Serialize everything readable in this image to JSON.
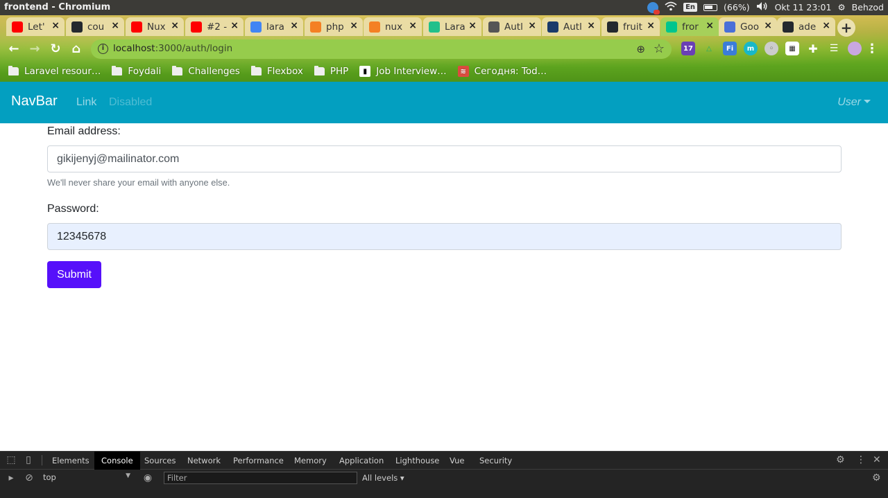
{
  "os": {
    "window_title": "frontend - Chromium",
    "lang": "En",
    "battery": "(66%)",
    "datetime": "Okt 11 23:01",
    "user": "Behzod"
  },
  "tabs": [
    {
      "label": "Let'",
      "icon": "youtube-icon",
      "color": "#ff0000"
    },
    {
      "label": "cou",
      "icon": "github-icon",
      "color": "#24292e"
    },
    {
      "label": "Nux",
      "icon": "youtube-icon",
      "color": "#ff0000"
    },
    {
      "label": "#2 -",
      "icon": "youtube-icon",
      "color": "#ff0000"
    },
    {
      "label": "lara",
      "icon": "google-icon",
      "color": "#4285f4"
    },
    {
      "label": "php",
      "icon": "stackoverflow-icon",
      "color": "#f48024"
    },
    {
      "label": "nux",
      "icon": "stackoverflow-icon",
      "color": "#f48024"
    },
    {
      "label": "Lara",
      "icon": "laracasts-icon",
      "color": "#21c08b"
    },
    {
      "label": "Autl",
      "icon": "avatar-icon",
      "color": "#555555"
    },
    {
      "label": "Autl",
      "icon": "plane-icon",
      "color": "#1a3a6a"
    },
    {
      "label": "fruit",
      "icon": "github-icon",
      "color": "#24292e"
    },
    {
      "label": "fror",
      "icon": "nuxt-icon",
      "color": "#00c58e"
    },
    {
      "label": "Goo",
      "icon": "translate-icon",
      "color": "#4a6fd8"
    },
    {
      "label": "ade",
      "icon": "github-icon",
      "color": "#24292e"
    }
  ],
  "address_bar": {
    "host": "localhost",
    "path": ":3000/auth/login"
  },
  "bookmarks": [
    {
      "label": "Laravel resour…",
      "type": "folder"
    },
    {
      "label": "Foydali",
      "type": "folder"
    },
    {
      "label": "Challenges",
      "type": "folder"
    },
    {
      "label": "Flexbox",
      "type": "folder"
    },
    {
      "label": "PHP",
      "type": "folder"
    },
    {
      "label": "Job Interview…",
      "type": "site"
    },
    {
      "label": "Сегодня: Tod…",
      "type": "site"
    }
  ],
  "navbar": {
    "brand": "NavBar",
    "link": "Link",
    "disabled": "Disabled",
    "user": "User",
    "color": "#039fc0"
  },
  "form": {
    "email_label": "Email address:",
    "email_value": "gikijenyj@mailinator.com",
    "email_help": "We'll never share your email with anyone else.",
    "password_label": "Password:",
    "password_value": "12345678",
    "submit_label": "Submit",
    "submit_color": "#5610fa"
  },
  "devtools": {
    "tabs": [
      "Elements",
      "Console",
      "Sources",
      "Network",
      "Performance",
      "Memory",
      "Application",
      "Lighthouse",
      "Vue",
      "Security"
    ],
    "active_tab": "Console",
    "context": "top",
    "filter_placeholder": "Filter",
    "levels": "All levels"
  }
}
